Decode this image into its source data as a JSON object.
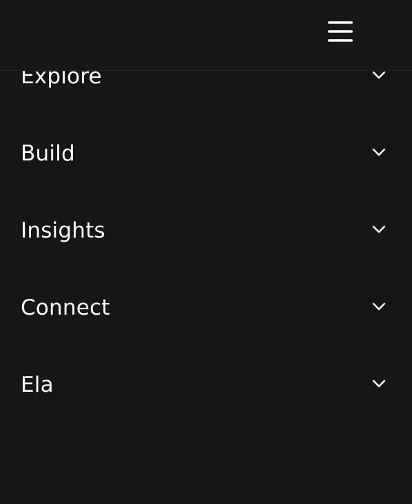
{
  "header": {
    "menu_icon": "hamburger-menu-icon"
  },
  "nav": {
    "items": [
      {
        "label": "Explore",
        "icon": "chevron-down-icon"
      },
      {
        "label": "Build",
        "icon": "chevron-down-icon"
      },
      {
        "label": "Insights",
        "icon": "chevron-down-icon"
      },
      {
        "label": "Connect",
        "icon": "chevron-down-icon"
      },
      {
        "label": "Ela",
        "icon": "chevron-down-icon"
      }
    ]
  },
  "colors": {
    "background": "#161616",
    "header_background": "#171717",
    "text": "#ffffff"
  }
}
